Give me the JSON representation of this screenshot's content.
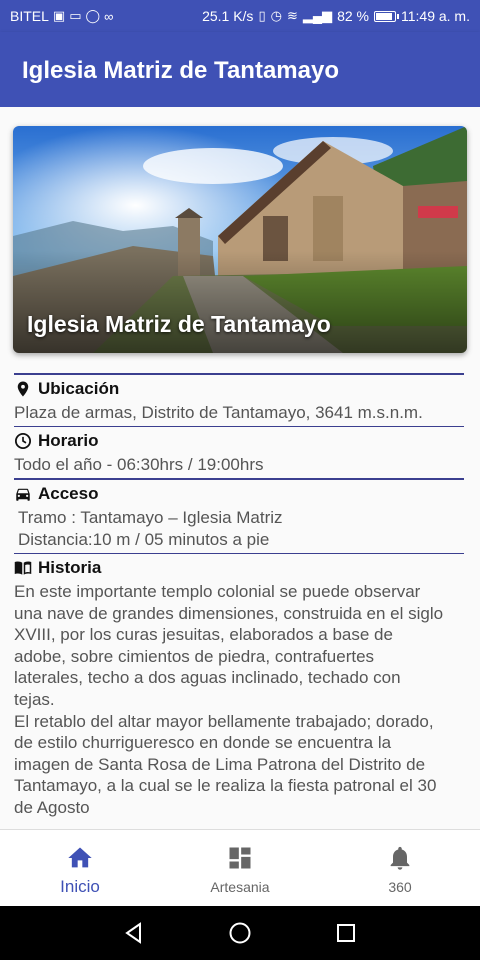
{
  "status_bar": {
    "carrier": "BITEL",
    "speed": "25.1 K/s",
    "battery": "82 %",
    "battery_level": 0.82,
    "time": "11:49 a. m."
  },
  "app_bar": {
    "title": "Iglesia Matriz de Tantamayo"
  },
  "hero": {
    "title": "Iglesia Matriz de Tantamayo"
  },
  "sections": {
    "ubicacion": {
      "label": "Ubicación",
      "text": "Plaza de armas, Distrito de Tantamayo, 3641 m.s.n.m."
    },
    "horario": {
      "label": "Horario",
      "text": "Todo el año - 06:30hrs / 19:00hrs"
    },
    "acceso": {
      "label": "Acceso",
      "line1": "Tramo : Tantamayo – Iglesia Matriz",
      "line2": "Distancia:10 m / 05 minutos a pie"
    },
    "historia": {
      "label": "Historia",
      "p1": "En este importante templo colonial se puede observar una nave de grandes dimensiones, construida en el siglo XVIII, por los curas jesuitas, elaborados a base de adobe, sobre cimientos de piedra, contrafuertes laterales, techo a dos aguas inclinado, techado con tejas.",
      "p2": "El retablo del altar mayor bellamente trabajado; dorado, de estilo churrigueresco en donde se encuentra la imagen de Santa Rosa de Lima Patrona del Distrito de Tantamayo, a la cual se le realiza la fiesta patronal el 30 de Agosto"
    }
  },
  "bottom_nav": {
    "items": [
      {
        "label": "Inicio",
        "icon": "home-icon",
        "active": true
      },
      {
        "label": "Artesania",
        "icon": "dashboard-icon",
        "active": false
      },
      {
        "label": "360",
        "icon": "bell-icon",
        "active": false
      }
    ]
  },
  "colors": {
    "primary": "#3f51b5",
    "rule": "#3b3f8f",
    "text_muted": "#555555",
    "nav_inactive": "#666666"
  }
}
